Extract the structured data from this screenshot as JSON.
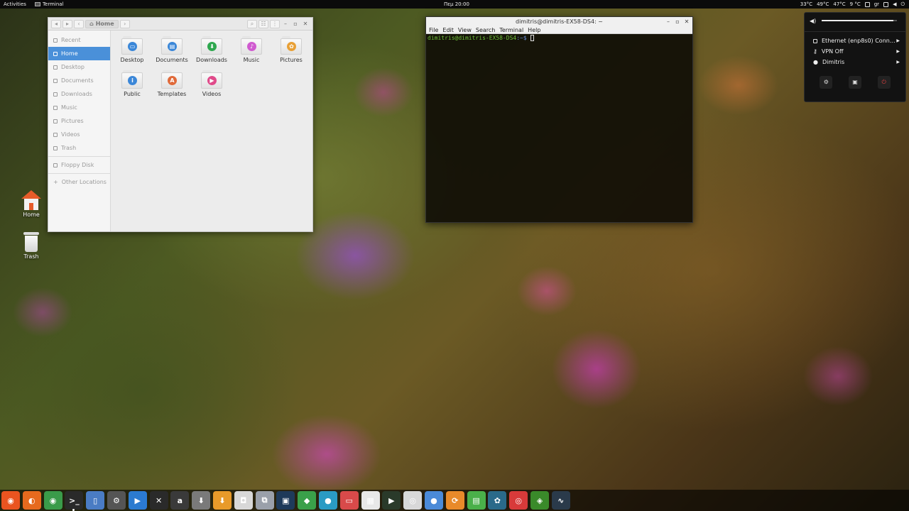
{
  "topbar": {
    "activities": "Activities",
    "app_name": "Terminal",
    "clock": "Πεμ 20:00",
    "tray": [
      "33°C",
      "49°C",
      "47°C",
      "9 °C",
      "gr"
    ]
  },
  "desktop": {
    "home_label": "Home",
    "trash_label": "Trash"
  },
  "file_manager": {
    "path": "Home",
    "sidebar": [
      {
        "label": "Recent"
      },
      {
        "label": "Home"
      },
      {
        "label": "Desktop"
      },
      {
        "label": "Documents"
      },
      {
        "label": "Downloads"
      },
      {
        "label": "Music"
      },
      {
        "label": "Pictures"
      },
      {
        "label": "Videos"
      },
      {
        "label": "Trash"
      },
      {
        "label": "Floppy Disk"
      },
      {
        "label": "Other Locations"
      }
    ],
    "folders": [
      {
        "label": "Desktop",
        "icon": "desktop-folder-icon",
        "color": "#3b87d8"
      },
      {
        "label": "Documents",
        "icon": "documents-folder-icon",
        "color": "#3b87d8"
      },
      {
        "label": "Downloads",
        "icon": "downloads-folder-icon",
        "color": "#2fa84f"
      },
      {
        "label": "Music",
        "icon": "music-folder-icon",
        "color": "#d05bd0"
      },
      {
        "label": "Pictures",
        "icon": "pictures-folder-icon",
        "color": "#e8a036"
      },
      {
        "label": "Public",
        "icon": "public-folder-icon",
        "color": "#3b87d8"
      },
      {
        "label": "Templates",
        "icon": "templates-folder-icon",
        "color": "#e06a3a"
      },
      {
        "label": "Videos",
        "icon": "videos-folder-icon",
        "color": "#e04a8a"
      }
    ]
  },
  "terminal": {
    "title": "dimitris@dimitris-EX58-DS4: ~",
    "menu": [
      "File",
      "Edit",
      "View",
      "Search",
      "Terminal",
      "Help"
    ],
    "prompt_user": "dimitris@dimitris-EX58-DS4",
    "prompt_path": ":~$"
  },
  "system_menu": {
    "volume_level": 0.95,
    "items": [
      {
        "label": "Ethernet (enp8s0) Conn…",
        "icon": "ethernet-icon"
      },
      {
        "label": "VPN Off",
        "icon": "vpn-key-icon"
      },
      {
        "label": "Dimitris",
        "icon": "user-icon"
      }
    ],
    "actions": [
      "settings-icon",
      "lock-icon",
      "power-icon"
    ]
  },
  "dock": [
    {
      "name": "ubuntu-software-icon",
      "color": "#e95420",
      "glyph": "◉"
    },
    {
      "name": "firefox-icon",
      "color": "#e66a1e",
      "glyph": "◐"
    },
    {
      "name": "chrome-icon",
      "color": "#3a9b4a",
      "glyph": "◉"
    },
    {
      "name": "terminal-icon",
      "color": "#2a2a2a",
      "glyph": ">_",
      "active": true
    },
    {
      "name": "files-icon",
      "color": "#4a7cc4",
      "glyph": "▯"
    },
    {
      "name": "system-settings-icon",
      "color": "#555555",
      "glyph": "⚙"
    },
    {
      "name": "video-editor-icon",
      "color": "#2b7bd0",
      "glyph": "▶"
    },
    {
      "name": "tools-icon",
      "color": "#2a2a2a",
      "glyph": "✕"
    },
    {
      "name": "amazon-icon",
      "color": "#3a3a3a",
      "glyph": "a"
    },
    {
      "name": "archive-icon",
      "color": "#7a7a7a",
      "glyph": "⬇"
    },
    {
      "name": "downloader-icon",
      "color": "#e89a2a",
      "glyph": "⬇"
    },
    {
      "name": "camera-icon",
      "color": "#d8d8d8",
      "glyph": "◘"
    },
    {
      "name": "backup-icon",
      "color": "#9aa0aa",
      "glyph": "⧉"
    },
    {
      "name": "document-viewer-icon",
      "color": "#1e3a5a",
      "glyph": "▣"
    },
    {
      "name": "tag-icon",
      "color": "#3aa04a",
      "glyph": "◆"
    },
    {
      "name": "globe-icon",
      "color": "#2a9bc4",
      "glyph": "●"
    },
    {
      "name": "screenshot-icon",
      "color": "#d84a4a",
      "glyph": "▭"
    },
    {
      "name": "grid-app-icon",
      "color": "#e8e8e8",
      "glyph": "▦"
    },
    {
      "name": "media-player-icon",
      "color": "#2a3a2a",
      "glyph": "▶"
    },
    {
      "name": "help-lifebuoy-icon",
      "color": "#d8d8d8",
      "glyph": "◎"
    },
    {
      "name": "chat-icon",
      "color": "#4a8ad8",
      "glyph": "●"
    },
    {
      "name": "sync-icon",
      "color": "#e88a2a",
      "glyph": "⟳"
    },
    {
      "name": "spreadsheet-icon",
      "color": "#4ab04a",
      "glyph": "▤"
    },
    {
      "name": "molecule-icon",
      "color": "#2a6a8a",
      "glyph": "✿"
    },
    {
      "name": "search-app-icon",
      "color": "#d83a3a",
      "glyph": "◎"
    },
    {
      "name": "nvidia-icon",
      "color": "#3a8a2a",
      "glyph": "◈"
    },
    {
      "name": "system-monitor-icon",
      "color": "#2a3a4a",
      "glyph": "∿"
    }
  ]
}
